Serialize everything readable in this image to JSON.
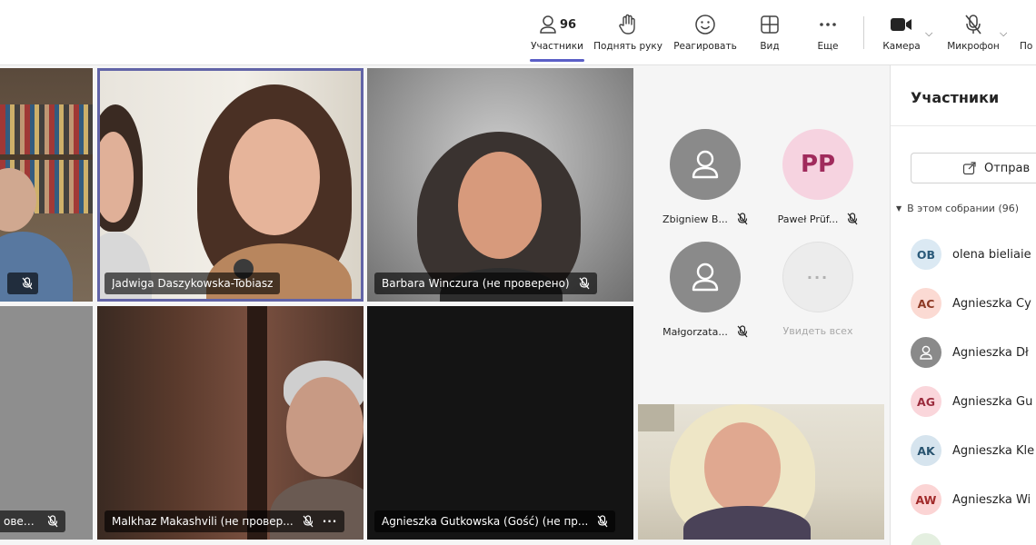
{
  "toolbar": {
    "participants": {
      "label": "Участники",
      "count": "96",
      "icon": "people-icon"
    },
    "raise_hand": {
      "label": "Поднять руку",
      "icon": "hand-icon"
    },
    "react": {
      "label": "Реагировать",
      "icon": "smiley-icon"
    },
    "view": {
      "label": "Вид",
      "icon": "grid-icon"
    },
    "more": {
      "label": "Еще",
      "icon": "ellipsis-icon"
    },
    "camera": {
      "label": "Камера",
      "icon": "camera-icon"
    },
    "microphone": {
      "label": "Микрофон",
      "icon": "mic-off-icon"
    },
    "share_partial": {
      "label": "По"
    },
    "accent_color": "#5b5fc7"
  },
  "tiles": {
    "tile_1": {
      "name": ""
    },
    "tile_2": {
      "name": "Jadwiga Daszykowska-Tobiasz",
      "active_speaker": true
    },
    "tile_3": {
      "name": "Barbara Winczura (не проверено)"
    },
    "tile_4": {
      "name": "оверен..."
    },
    "tile_5": {
      "name": "Malkhaz Makashvili (не провер...",
      "more": "···"
    },
    "tile_6": {
      "name": "Agnieszka Gutkowska (Gość) (не пр..."
    },
    "tile_7": {
      "name": ""
    }
  },
  "avatars": [
    {
      "name": "Zbigniew B...",
      "initials": "",
      "muted": true
    },
    {
      "name": "Paweł Prüf...",
      "initials": "PP",
      "muted": true,
      "color": "#f6d3e0",
      "text_color": "#a02b5c"
    },
    {
      "name": "Małgorzata...",
      "initials": "",
      "muted": true
    },
    {
      "name": "Увидеть всех",
      "initials": "···",
      "muted": false
    }
  ],
  "panel": {
    "title": "Участники",
    "share_label": "Отправ",
    "section": "В этом собрании (96)",
    "participants": [
      {
        "initials": "OB",
        "name": "olena bieliaie",
        "bg": "#dbe9f3",
        "fg": "#2b5a7a"
      },
      {
        "initials": "AC",
        "name": "Agnieszka Cy",
        "bg": "#fbdad3",
        "fg": "#8e3a25"
      },
      {
        "initials": "",
        "name": "Agnieszka Dł",
        "bg": "#8a8a8a",
        "fg": "#ffffff"
      },
      {
        "initials": "AG",
        "name": "Agnieszka Gu",
        "bg": "#fad6db",
        "fg": "#9b2c3d"
      },
      {
        "initials": "AK",
        "name": "Agnieszka Kle",
        "bg": "#d6e4ee",
        "fg": "#28536f"
      },
      {
        "initials": "AW",
        "name": "Agnieszka Wi",
        "bg": "#fbd4d4",
        "fg": "#a12a2a"
      }
    ]
  }
}
